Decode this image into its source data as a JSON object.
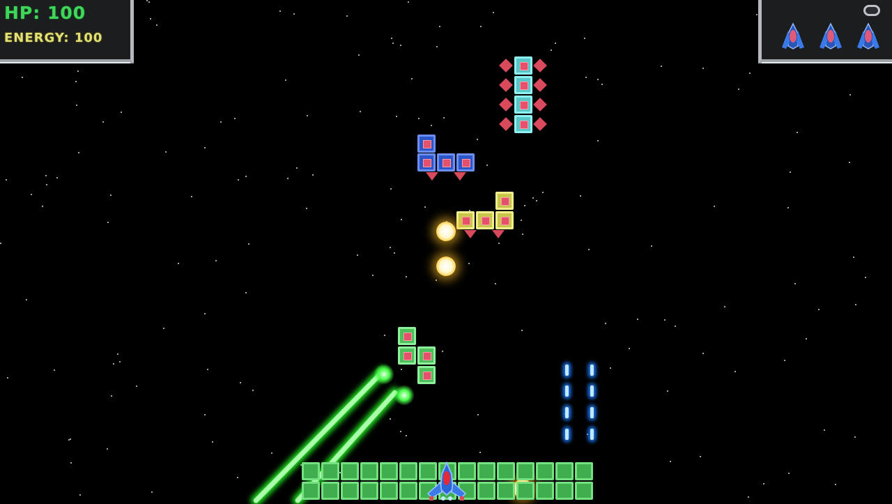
{
  "hud": {
    "hp_label": "HP:",
    "hp_value": "100",
    "energy_label": "ENERGY:",
    "energy_value": "100",
    "lives": 3,
    "pause_icon": "pause-pill-icon"
  },
  "colors": {
    "background": "#000000",
    "hp_text": "#3fd65a",
    "energy_text": "#e2df73",
    "hud_panel": "#1b1d1f",
    "laser": "#22e022",
    "enemy_bullet": "#ffd04a",
    "player_bolt": "#1f7dff"
  },
  "entities": {
    "enemies": [
      {
        "name": "cyan-vertical-block-enemy",
        "color": "cyan",
        "cells": 4
      },
      {
        "name": "blue-l-block-enemy",
        "color": "blue",
        "cells": 4
      },
      {
        "name": "yellow-l-block-enemy",
        "color": "yellow",
        "cells": 4
      },
      {
        "name": "green-s-block-enemy",
        "color": "green",
        "cells": 4
      }
    ],
    "player_ship": "blue-fighter-ship",
    "floor_blocks": "green-block-barrier"
  }
}
